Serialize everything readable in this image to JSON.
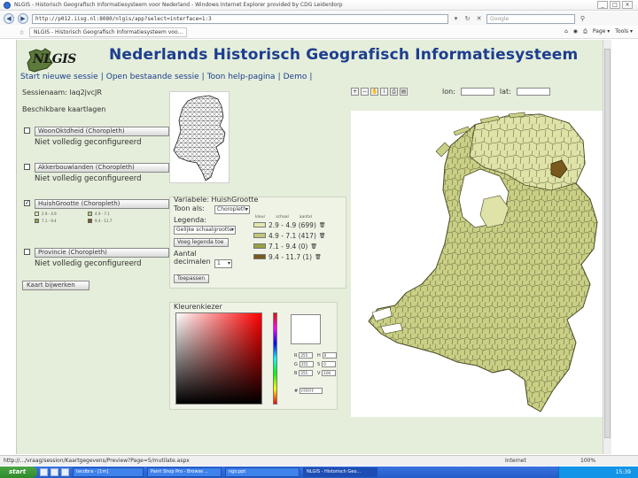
{
  "browser": {
    "window_title": "NLGIS - Historisch Geografisch Informatiesysteem voor Nederland - Windows Internet Explorer provided by CDG Leiderdorp",
    "url": "http://p012.iisg.nl:8080/nlgis/app?select=interface=1:3",
    "search_placeholder": "Google",
    "tab_title": "NLGIS - Historisch Geografisch Informatiesysteem voo...",
    "tools": [
      "Page ▾",
      "Tools ▾"
    ],
    "status_text": "http://.../vraag/session/Kaartgegevens/Preview?Page=5/mutilate.aspx",
    "status_zone": "Internet",
    "status_zoom": "100%"
  },
  "page": {
    "logo": "NLGIS",
    "title": "Nederlands Historisch Geografisch Informatiesysteem",
    "menu": [
      "Start nieuwe sessie",
      "Open bestaande sessie",
      "Toon help-pagina",
      "Demo"
    ],
    "session_label": "Sessienaam: laq2jvcJR",
    "layers_title": "Beschikbare kaartlagen",
    "layers": [
      {
        "checked": false,
        "name": "WoonOktdheid (Choropleth)",
        "status": "Niet volledig geconfigureerd"
      },
      {
        "checked": false,
        "name": "Akkerbouwlanden (Choropleth)",
        "status": "Niet volledig geconfigureerd"
      },
      {
        "checked": true,
        "name": "HuishGrootte (Choropleth)",
        "status": ""
      },
      {
        "checked": false,
        "name": "Provincie (Choropleth)",
        "status": "Niet volledig geconfigureerd"
      }
    ],
    "mini_legend": [
      "2.9 - 4.9",
      "4.9 - 7.1",
      "7.1 - 9.4",
      "9.4 - 11.7"
    ],
    "kaart_button": "Kaart bijwerken",
    "lon_label": "lon:",
    "lat_label": "lat:"
  },
  "variable_panel": {
    "variable_label": "Variabele: HuishGrootte",
    "show_as_label": "Toon als:",
    "show_as_value": "Choropleth",
    "legend_label": "Legenda:",
    "legend_value": "Gelijke schaalgrootte",
    "add_legend_button": "Voeg legenda toe",
    "decimals_label_1": "Aantal",
    "decimals_label_2": "decimalen",
    "decimals_value": "1",
    "apply_button": "Toepassen",
    "legend_headers": [
      "kleur",
      "schaal",
      "aantal"
    ],
    "legend_rows": [
      {
        "range": "2.9 - 4.9 (699)",
        "color": "#e4e8b0"
      },
      {
        "range": "4.9 - 7.1 (417)",
        "color": "#c3c77a"
      },
      {
        "range": "7.1 - 9.4 (0)",
        "color": "#9aa043"
      },
      {
        "range": "9.4 - 11.7 (1)",
        "color": "#7a5a1c"
      }
    ]
  },
  "color_picker": {
    "title": "Kleurenkiezer",
    "fields": [
      {
        "label": "R",
        "value": "255"
      },
      {
        "label": "G",
        "value": "255"
      },
      {
        "label": "B",
        "value": "255"
      },
      {
        "label": "H",
        "value": "0"
      },
      {
        "label": "S",
        "value": "0"
      },
      {
        "label": "V",
        "value": "100"
      },
      {
        "label": "#",
        "value": "FFFFFF"
      }
    ]
  },
  "taskbar": {
    "start": "start",
    "tasks": [
      "tecdbra - [1m]",
      "Paint Shop Pro - Browse ...",
      "ngo.ppt",
      "NLGIS - Historisch Geo..."
    ],
    "clock": "15:39"
  },
  "colors": {
    "accent": "#1d3d8f",
    "page_bg": "#e4eeda",
    "map_fill": "#c9cf85",
    "map_fill_light": "#e4e8b0",
    "map_highlight": "#7a5a1c",
    "map_border": "#4a4a25"
  }
}
